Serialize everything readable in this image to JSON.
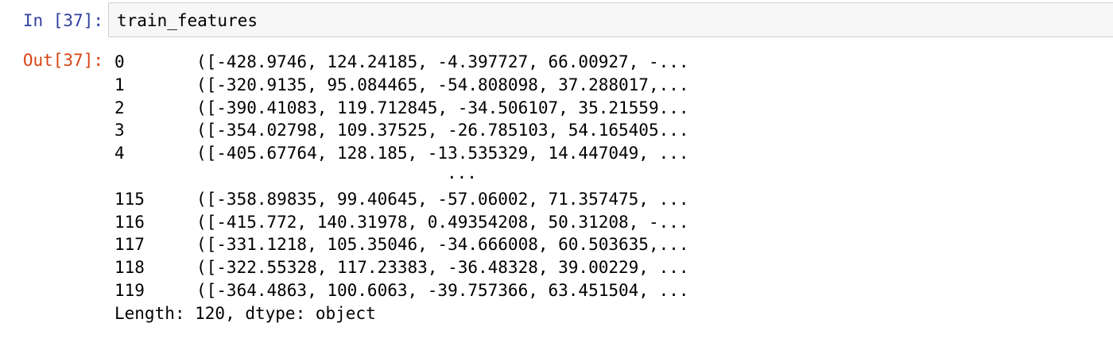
{
  "cell": {
    "in_prompt": "In [37]:",
    "input_code": "train_features",
    "out_prompt": "Out[37]:"
  },
  "output": {
    "rows_top": [
      {
        "index": "0",
        "value": "([-428.9746, 124.24185, -4.397727, 66.00927, -..."
      },
      {
        "index": "1",
        "value": "([-320.9135, 95.084465, -54.808098, 37.288017,..."
      },
      {
        "index": "2",
        "value": "([-390.41083, 119.712845, -34.506107, 35.21559..."
      },
      {
        "index": "3",
        "value": "([-354.02798, 109.37525, -26.785103, 54.165405..."
      },
      {
        "index": "4",
        "value": "([-405.67764, 128.185, -13.535329, 14.447049, ..."
      }
    ],
    "ellipsis": "...",
    "rows_bottom": [
      {
        "index": "115",
        "value": "([-358.89835, 99.40645, -57.06002, 71.357475, ..."
      },
      {
        "index": "116",
        "value": "([-415.772, 140.31978, 0.49354208, 50.31208, -..."
      },
      {
        "index": "117",
        "value": "([-331.1218, 105.35046, -34.666008, 60.503635,..."
      },
      {
        "index": "118",
        "value": "([-322.55328, 117.23383, -36.48328, 39.00229, ..."
      },
      {
        "index": "119",
        "value": "([-364.4863, 100.6063, -39.757366, 63.451504, ..."
      }
    ],
    "footer": "Length: 120, dtype: object"
  },
  "colors": {
    "in_prompt": "#303f9f",
    "out_prompt": "#d84315",
    "input_background": "#f7f7f7",
    "input_border": "#cfcfcf"
  }
}
